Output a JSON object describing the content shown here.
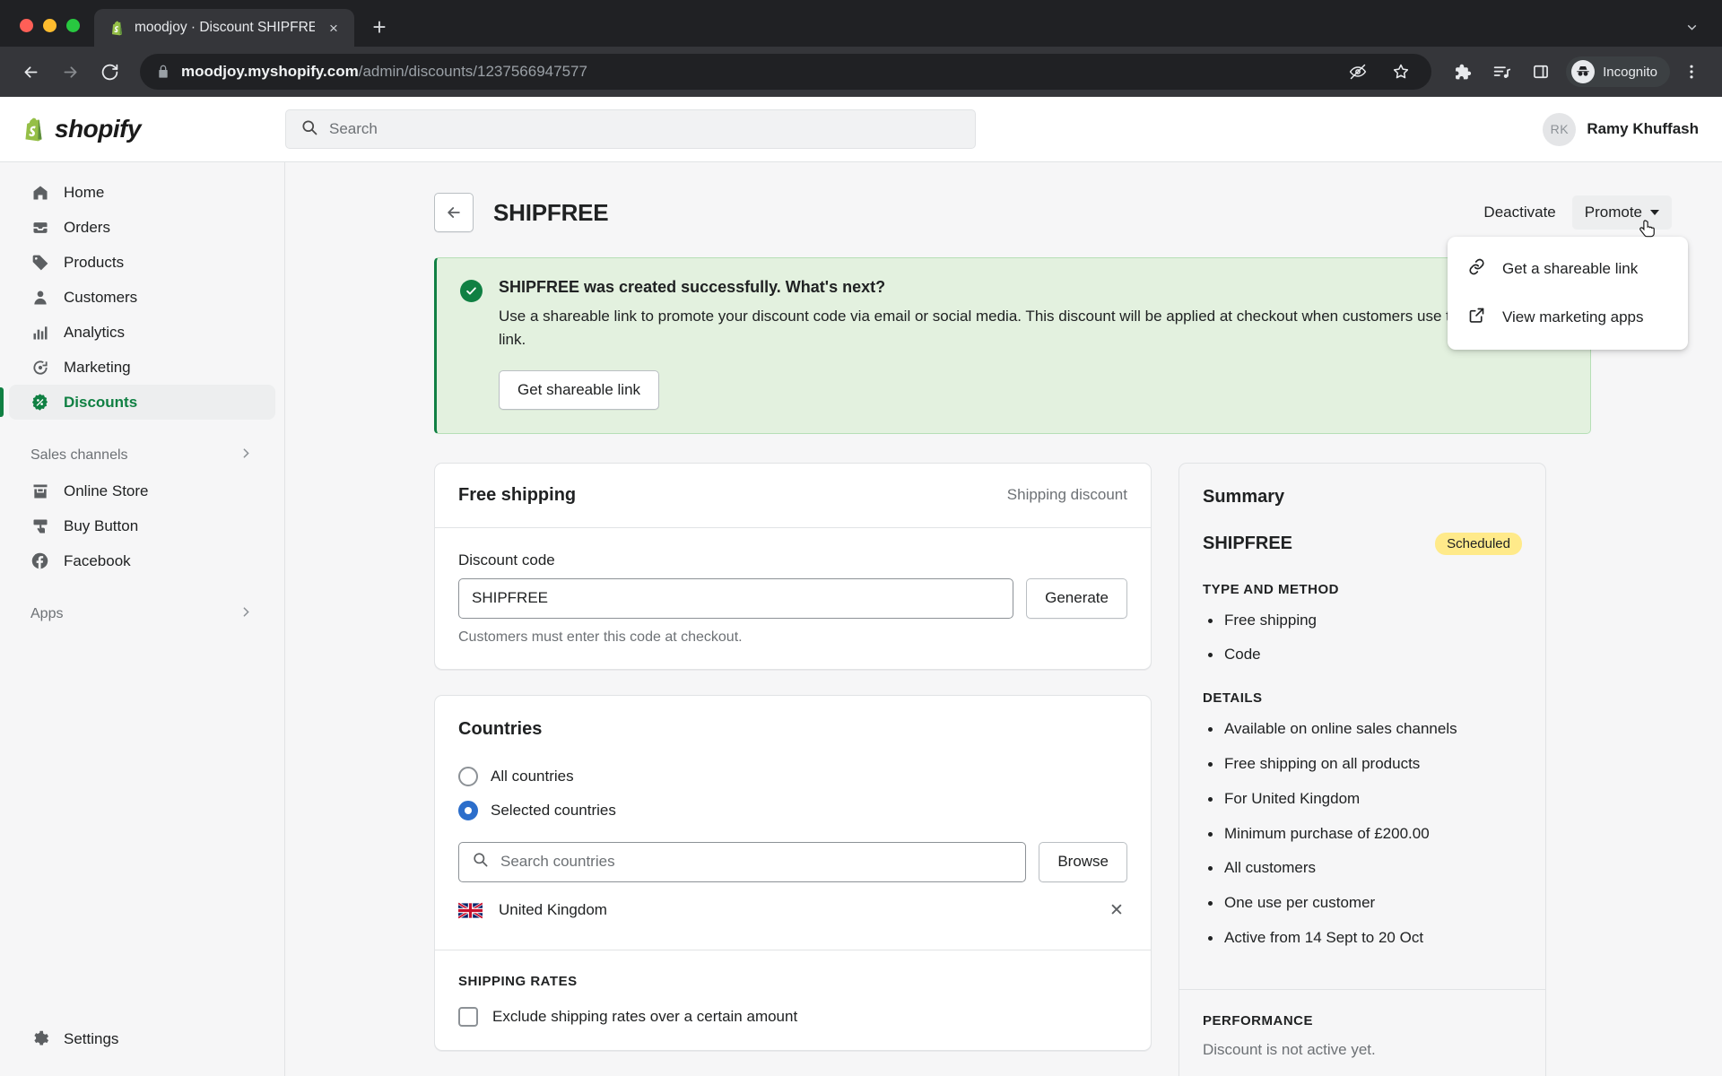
{
  "browser": {
    "tab": {
      "title": "moodjoy · Discount SHIPFREE",
      "favicon": "shopify-bag-icon",
      "close": "×"
    },
    "new_tab": "+",
    "url_domain": "moodjoy.myshopify.com",
    "url_path": "/admin/discounts/1237566947577",
    "profile_label": "Incognito",
    "icons": [
      "back-icon",
      "forward-icon",
      "reload-icon",
      "lock-icon",
      "eye-off-icon",
      "star-icon",
      "extensions-icon",
      "reading-list-icon",
      "side-panel-icon",
      "incognito-icon",
      "browser-menu-icon",
      "tab-list-icon"
    ]
  },
  "topbar": {
    "brand": "shopify",
    "search_placeholder": "Search",
    "user_initials": "RK",
    "user_name": "Ramy Khuffash"
  },
  "sidebar": {
    "items": [
      {
        "label": "Home",
        "icon": "home-icon"
      },
      {
        "label": "Orders",
        "icon": "orders-inbox-icon"
      },
      {
        "label": "Products",
        "icon": "tag-icon"
      },
      {
        "label": "Customers",
        "icon": "person-icon"
      },
      {
        "label": "Analytics",
        "icon": "bar-chart-icon"
      },
      {
        "label": "Marketing",
        "icon": "megaphone-target-icon"
      },
      {
        "label": "Discounts",
        "icon": "discount-badge-icon"
      }
    ],
    "sales_channels_label": "Sales channels",
    "channels": [
      {
        "label": "Online Store",
        "icon": "storefront-icon"
      },
      {
        "label": "Buy Button",
        "icon": "buy-button-icon"
      },
      {
        "label": "Facebook",
        "icon": "facebook-icon"
      }
    ],
    "apps_label": "Apps",
    "settings_label": "Settings"
  },
  "page": {
    "title": "SHIPFREE",
    "deactivate_label": "Deactivate",
    "promote_label": "Promote",
    "promote_menu": [
      {
        "label": "Get a shareable link",
        "icon": "link-icon"
      },
      {
        "label": "View marketing apps",
        "icon": "external-link-icon"
      }
    ]
  },
  "banner": {
    "title": "SHIPFREE was created successfully. What's next?",
    "text": "Use a shareable link to promote your discount code via email or social media. This discount will be applied at checkout when customers use this link.",
    "button": "Get shareable link"
  },
  "free_shipping_card": {
    "title": "Free shipping",
    "aside": "Shipping discount",
    "code_label": "Discount code",
    "code_value": "SHIPFREE",
    "generate_label": "Generate",
    "helper": "Customers must enter this code at checkout."
  },
  "countries_card": {
    "title": "Countries",
    "option_all": "All countries",
    "option_selected": "Selected countries",
    "selected_option": "Selected countries",
    "search_placeholder": "Search countries",
    "browse_label": "Browse",
    "selected_countries": [
      {
        "name": "United Kingdom",
        "flag": "uk-flag-icon"
      }
    ],
    "shipping_rates_label": "SHIPPING RATES",
    "exclude_label": "Exclude shipping rates over a certain amount",
    "exclude_checked": false
  },
  "summary": {
    "title": "Summary",
    "code": "SHIPFREE",
    "status_badge": "Scheduled",
    "badge_color": "#ffea8a",
    "type_method_label": "TYPE AND METHOD",
    "type_method": [
      "Free shipping",
      "Code"
    ],
    "details_label": "DETAILS",
    "details": [
      "Available on online sales channels",
      "Free shipping on all products",
      "For United Kingdom",
      "Minimum purchase of £200.00",
      "All customers",
      "One use per customer",
      "Active from 14 Sept to 20 Oct"
    ],
    "performance_label": "PERFORMANCE",
    "performance_text": "Discount is not active yet."
  },
  "colors": {
    "accent_green": "#108043",
    "banner_bg": "#e3f1df",
    "focus_blue": "#2c6ecb"
  }
}
